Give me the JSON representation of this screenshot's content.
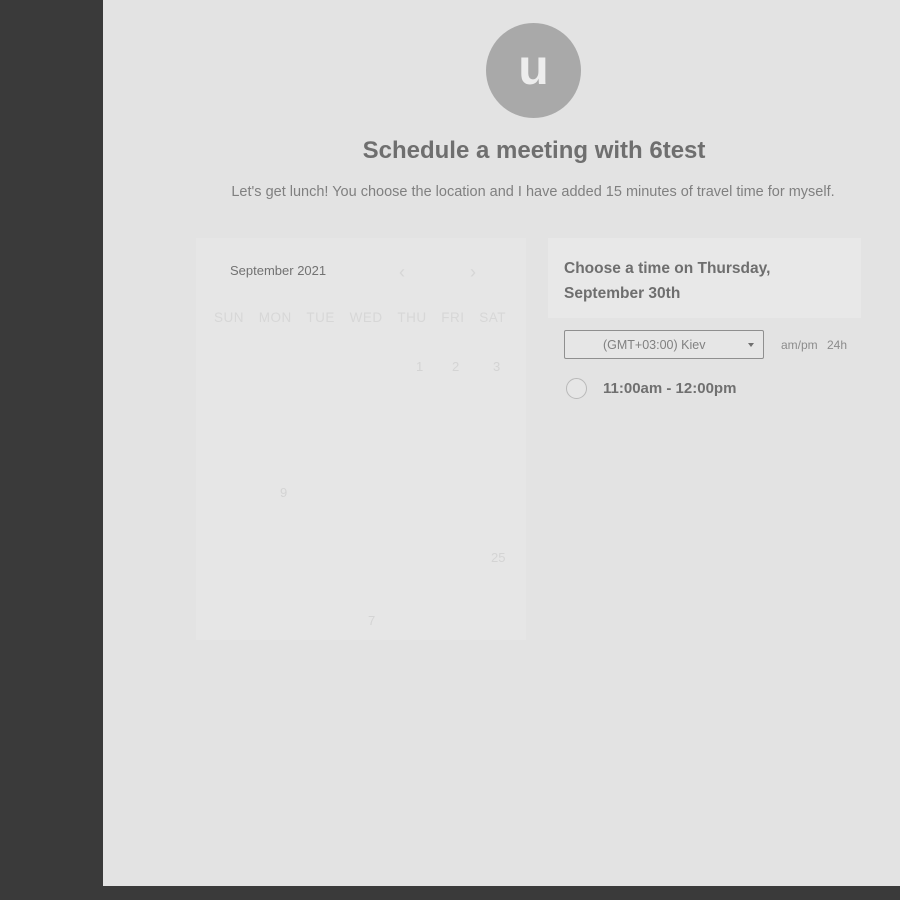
{
  "host": {
    "avatar_initial": "u",
    "title": "Schedule a meeting with 6test",
    "description": "Let's get lunch! You choose the location and I have added 15 minutes of travel time for myself."
  },
  "calendar": {
    "month_label": "September 2021",
    "prev_icon": "‹",
    "next_icon": "›",
    "weekdays": [
      "SUN",
      "MON",
      "TUE",
      "WED",
      "THU",
      "FRI",
      "SAT"
    ],
    "visible_days": [
      "1",
      "2",
      "3",
      "9",
      "25",
      "7"
    ]
  },
  "schedule": {
    "heading": "Choose a time on Thursday, September 30th",
    "timezone": "(GMT+03:00) Kiev",
    "format_ampm": "am/pm",
    "format_24h": "24h",
    "slots": [
      "11:00am - 12:00pm"
    ]
  }
}
